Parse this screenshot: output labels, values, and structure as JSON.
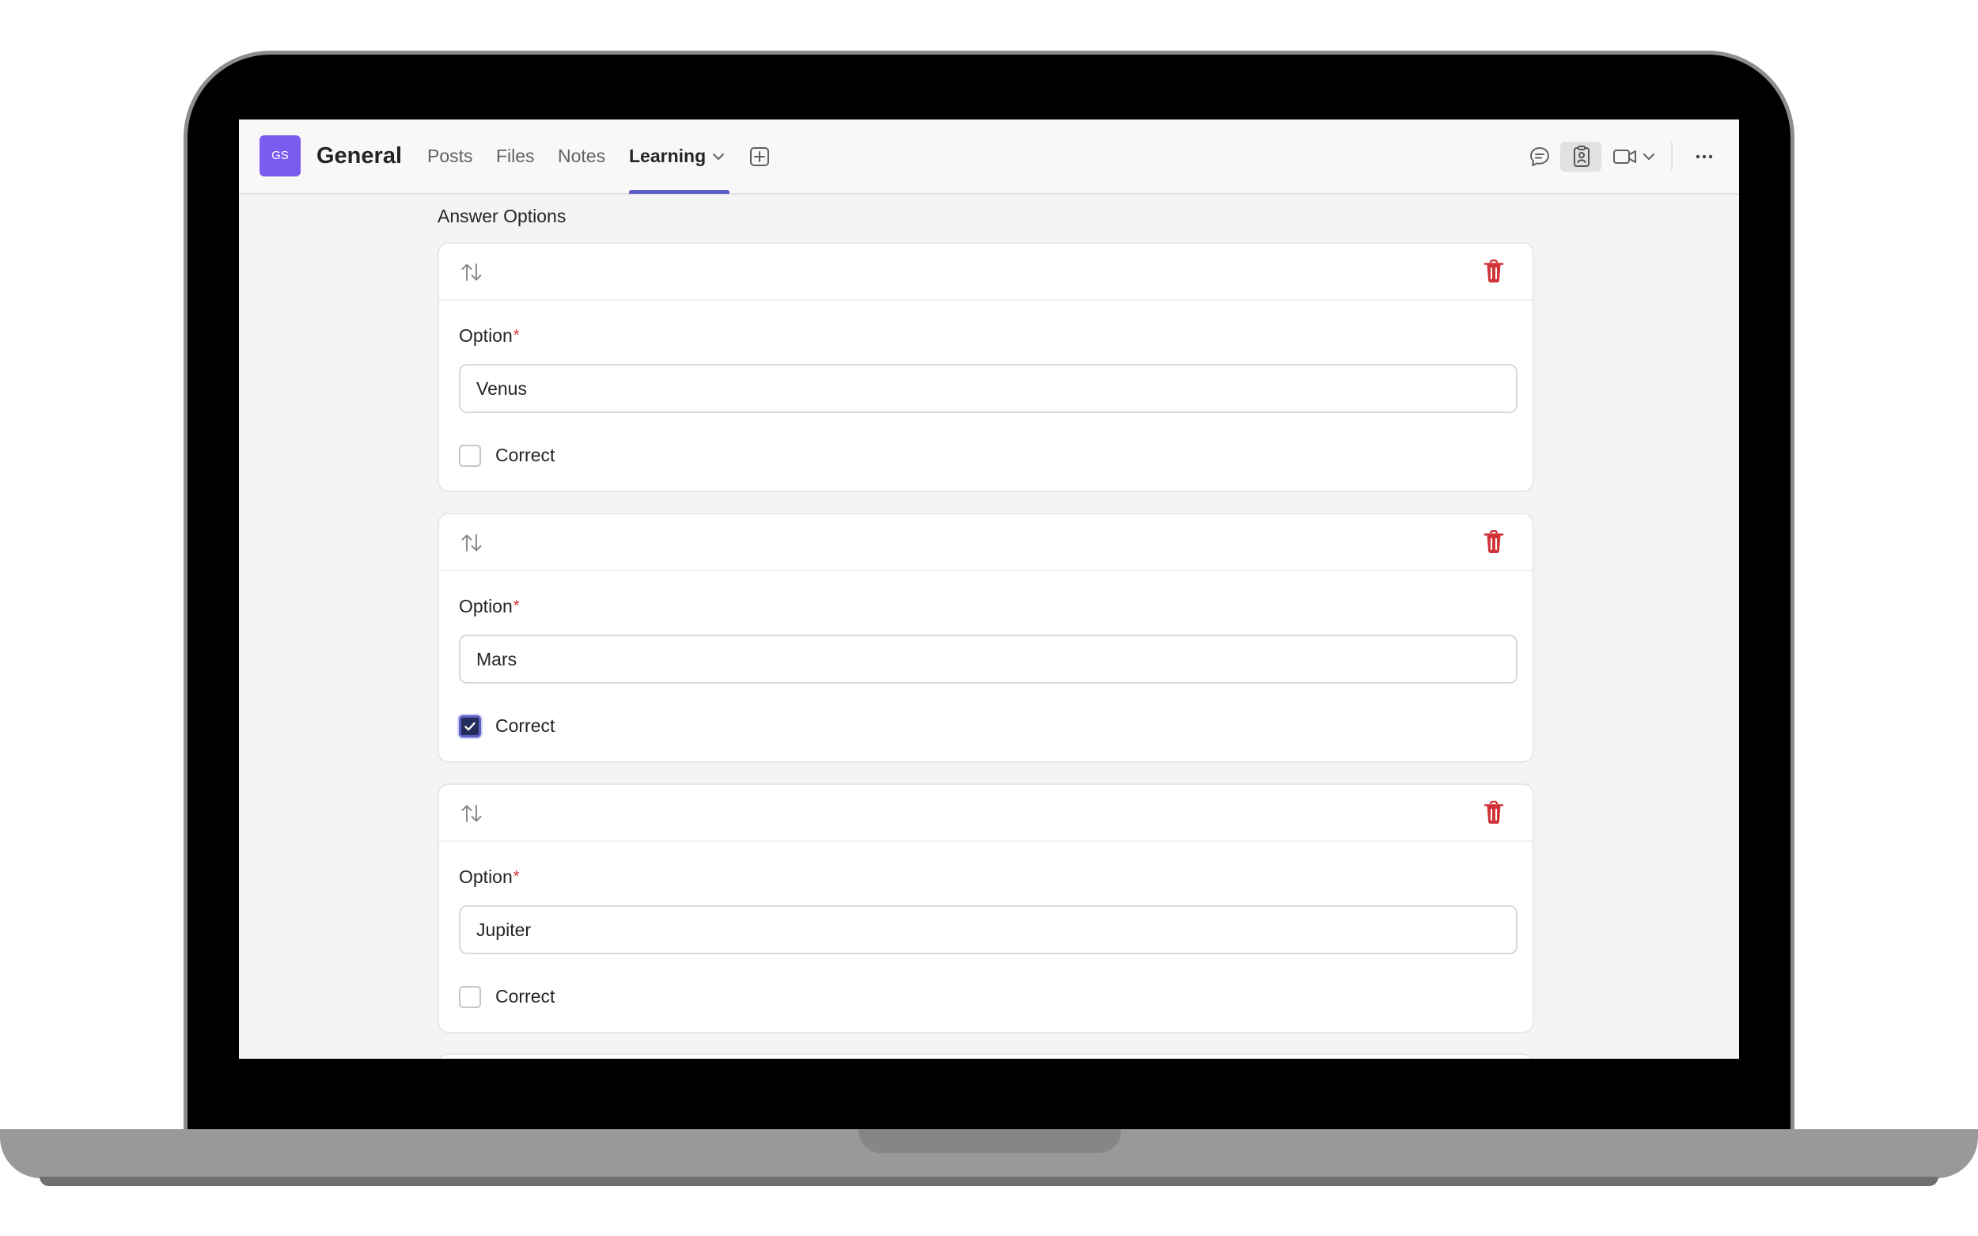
{
  "header": {
    "team_initials": "GS",
    "team_name": "General",
    "tabs": [
      {
        "label": "Posts",
        "active": false
      },
      {
        "label": "Files",
        "active": false
      },
      {
        "label": "Notes",
        "active": false
      },
      {
        "label": "Learning",
        "active": true
      }
    ],
    "icons": [
      "add-tab-icon",
      "chat-icon",
      "notes-icon",
      "video-call-icon",
      "chevron-down-icon",
      "more-icon"
    ]
  },
  "main": {
    "section_title": "Answer Options",
    "options": [
      {
        "label": "Option",
        "required_mark": "*",
        "value": "Venus",
        "correct_label": "Correct",
        "correct": false
      },
      {
        "label": "Option",
        "required_mark": "*",
        "value": "Mars",
        "correct_label": "Correct",
        "correct": true
      },
      {
        "label": "Option",
        "required_mark": "*",
        "value": "Jupiter",
        "correct_label": "Correct",
        "correct": false
      }
    ]
  },
  "colors": {
    "accent": "#5b5fc7",
    "avatar": "#7b5cf0",
    "delete": "#d13438",
    "checked_fill": "#242c5a"
  }
}
